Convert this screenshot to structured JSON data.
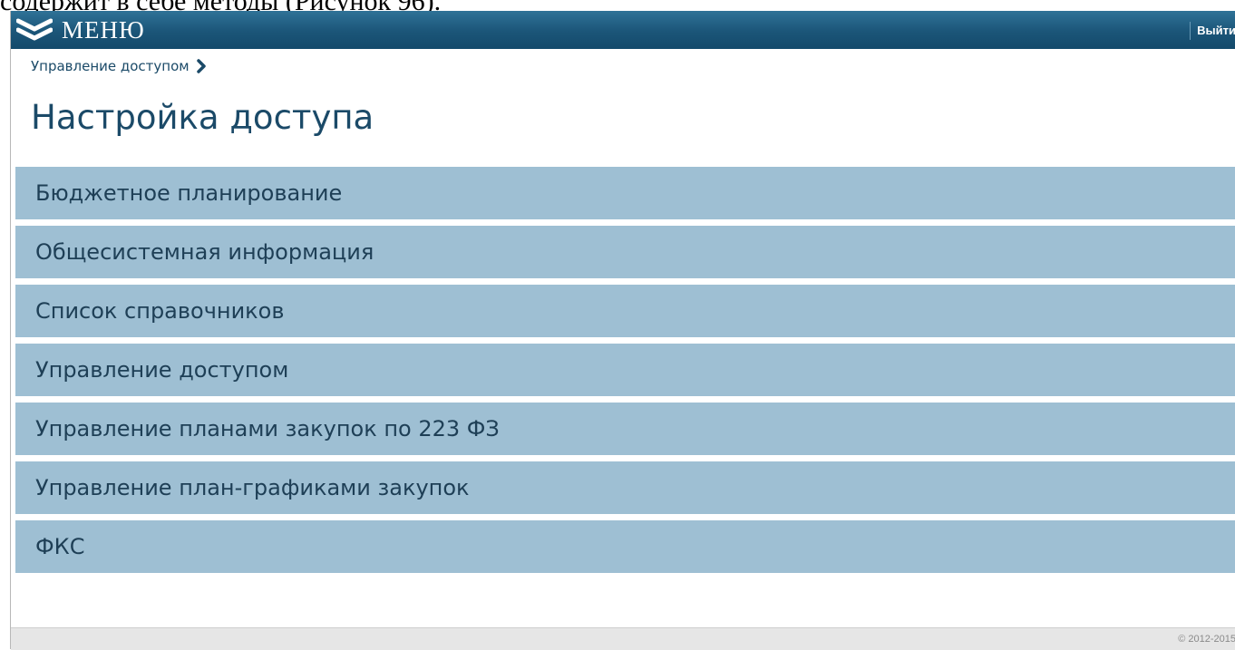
{
  "document_text": "содержит в себе методы (Рисунок 96).",
  "header": {
    "menu_label": "МЕНЮ",
    "logout_label": "Выйти",
    "menu_icon": "double-chevron-down-icon"
  },
  "breadcrumb": {
    "items": [
      "Управление доступом"
    ],
    "separator_icon": "chevron-right-icon"
  },
  "page": {
    "title": "Настройка доступа"
  },
  "sections": [
    "Бюджетное планирование",
    "Общесистемная информация",
    "Список справочников",
    "Управление доступом",
    "Управление планами закупок по 223 ФЗ",
    "Управление план-графиками закупок",
    "ФКС"
  ],
  "footer": {
    "copyright": "© 2012-2015"
  },
  "colors": {
    "topbar": "#1b5578",
    "section_bg": "#9ebfd3",
    "title_text": "#1b4a68",
    "footer_bg": "#e6e6e6"
  }
}
